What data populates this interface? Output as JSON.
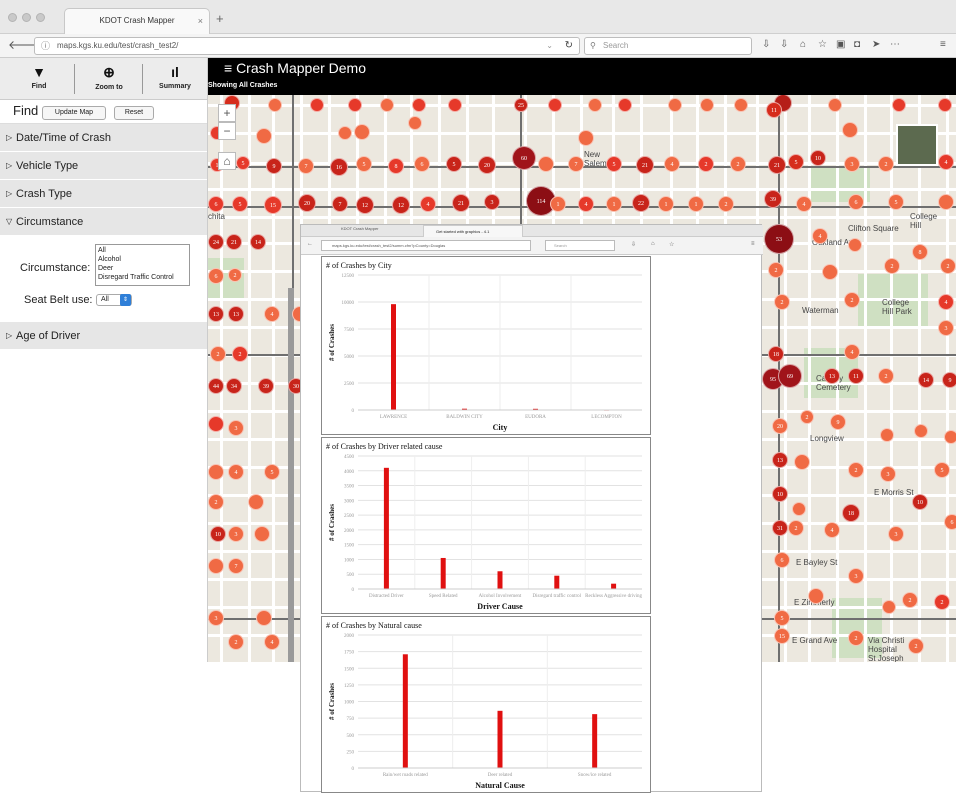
{
  "browser": {
    "tab_title": "KDOT Crash Mapper",
    "tab_close": "×",
    "new_tab": "+",
    "url": "maps.kgs.ku.edu/test/crash_test2/",
    "search_placeholder": "Search"
  },
  "sidebar": {
    "tools": [
      {
        "label": "Find",
        "icon": "filter-icon",
        "glyph": "▼"
      },
      {
        "label": "Zoom to",
        "icon": "zoom-icon",
        "glyph": "⊕"
      },
      {
        "label": "Summary",
        "icon": "bar-chart-icon",
        "glyph": "ıl"
      }
    ],
    "find_label": "Find",
    "update_btn": "Update Map",
    "reset_btn": "Reset",
    "accordion": [
      {
        "label": "Date/Time of Crash",
        "expanded": false
      },
      {
        "label": "Vehicle Type",
        "expanded": false
      },
      {
        "label": "Crash Type",
        "expanded": false
      },
      {
        "label": "Circumstance",
        "expanded": true
      },
      {
        "label": "Age of Driver",
        "expanded": false
      }
    ],
    "circumstance_label": "Circumstance:",
    "circumstance_options": [
      "All",
      "Alcohol",
      "Deer",
      "Disregard Traffic Control"
    ],
    "seatbelt_label": "Seat Belt use:",
    "seatbelt_value": "All"
  },
  "map": {
    "title": "Crash Mapper Demo",
    "subtitle": "Showing All Crashes",
    "labels": [
      {
        "text": "New\nSalem",
        "x": 376,
        "y": 92
      },
      {
        "text": "College\nHill",
        "x": 702,
        "y": 154
      },
      {
        "text": "College\nHill Park",
        "x": 674,
        "y": 240
      },
      {
        "text": "Calvary\nCemetery",
        "x": 608,
        "y": 316
      },
      {
        "text": "Longview",
        "x": 602,
        "y": 376
      },
      {
        "text": "Via Christi\nHospital\nSt Joseph",
        "x": 660,
        "y": 578
      },
      {
        "text": "Oakland Ave",
        "x": 604,
        "y": 180
      },
      {
        "text": "Waterman",
        "x": 594,
        "y": 248
      },
      {
        "text": "E Morris St",
        "x": 666,
        "y": 430
      },
      {
        "text": "E Bayley St",
        "x": 588,
        "y": 500
      },
      {
        "text": "E Zimmerly",
        "x": 586,
        "y": 540
      },
      {
        "text": "E Grand Ave",
        "x": 584,
        "y": 578
      },
      {
        "text": "Clifton Square",
        "x": 640,
        "y": 166
      },
      {
        "text": "chita",
        "x": 0,
        "y": 154
      }
    ]
  },
  "overlay_browser": {
    "tab1": "KDOT Crash Mapper",
    "tab2": "Get started with graphics - 4.1",
    "url": "maps.kgs.ku.edu/test/crash_test2/summ.cfm?pCounty=Douglas",
    "search": "Search"
  },
  "chart_data": [
    {
      "type": "bar",
      "title": "# of Crashes by City",
      "categories": [
        "LAWRENCE",
        "BALDWIN CITY",
        "EUDORA",
        "LECOMPTON"
      ],
      "values": [
        9800,
        120,
        110,
        20
      ],
      "xlabel": "City",
      "ylabel": "# of Crashes",
      "yticks": [
        0,
        2500,
        5000,
        7500,
        10000,
        12500
      ],
      "ylim": [
        0,
        12500
      ],
      "color": "#e01010"
    },
    {
      "type": "bar",
      "title": "# of Crashes by Driver related cause",
      "categories": [
        "Distracted Driver",
        "Speed Related",
        "Alcohol Involvement",
        "Disregard traffic control",
        "Reckless Aggressive driving"
      ],
      "values": [
        4100,
        1050,
        600,
        450,
        180
      ],
      "xlabel": "Driver Cause",
      "ylabel": "# of Crashes",
      "yticks": [
        0,
        500,
        1000,
        1500,
        2000,
        2500,
        3000,
        3500,
        4000,
        4500
      ],
      "ylim": [
        0,
        4500
      ],
      "color": "#e01010"
    },
    {
      "type": "bar",
      "title": "# of Crashes by Natural cause",
      "categories": [
        "Rain/wet roads related",
        "Deer related",
        "Snow/ice related"
      ],
      "values": [
        1710,
        860,
        810
      ],
      "xlabel": "Natural Cause",
      "ylabel": "# of Crashes",
      "yticks": [
        0,
        250,
        500,
        750,
        1000,
        1250,
        1500,
        1750,
        2000
      ],
      "ylim": [
        0,
        2000
      ],
      "color": "#e01010"
    }
  ]
}
